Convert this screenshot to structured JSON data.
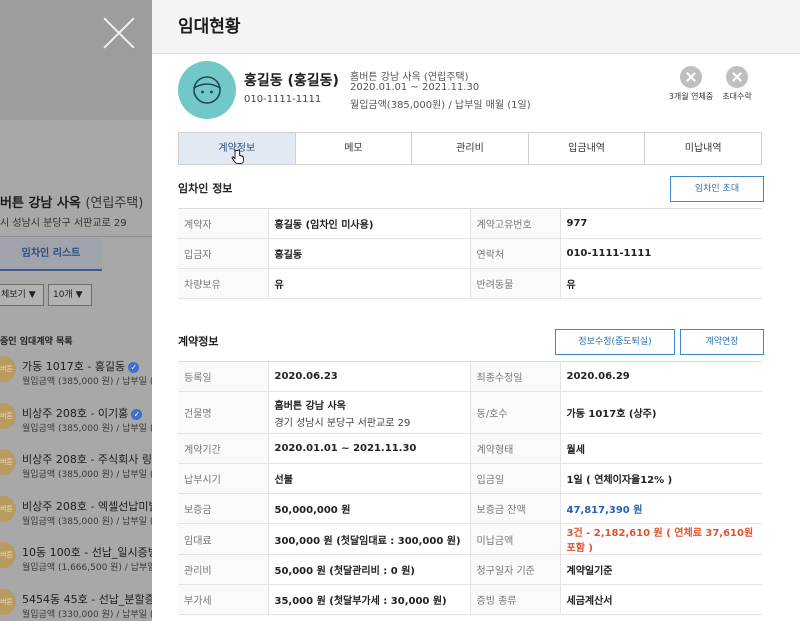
{
  "background": {
    "property_title": "버튼 강남 사옥",
    "property_type": "(연립주택)",
    "address": "시 성남시 분당구 서판교로 29",
    "tab_label": "임차인 리스트",
    "filter_select": "체보기 ▼",
    "page_size_select": "10개 ▼",
    "list_title": "중인 임대계약 목록",
    "avatar_text": "버튼",
    "items": [
      {
        "name": "가동 1017호 - 홍길동",
        "sub": "월입금액 (385,000 원) / 납부일 (1일",
        "verified": true
      },
      {
        "name": "비상주 208호 - 이기홍",
        "sub": "월입금액 (385,000 원) / 납부일 (1일",
        "verified": true
      },
      {
        "name": "비상주 208호 - 주식회사 링크해",
        "sub": "월입금액 (385,000 원) / 납부일 (1일",
        "verified": false
      },
      {
        "name": "비상주 208호 - 엑셀선납미발행",
        "sub": "월입금액 (385,000 원) / 납부일 (1일",
        "verified": false
      },
      {
        "name": "10동 100호 - 선납_일시증빙_오",
        "sub": "월입금액 (1,666,500 원) / 납부일 (1",
        "verified": false
      },
      {
        "name": "5454동 45호 - 선납_분할증빙",
        "sub": "월입금액 (330,000 원) / 납부일 (1일",
        "verified": false
      }
    ],
    "check_glyph": "✓"
  },
  "panel": {
    "title": "임대현황",
    "profile": {
      "name": "홍길동 (홍길동)",
      "phone": "010-1111-1111",
      "property": "홈버튼 강남 사옥 (연립주택)",
      "period": "2020.01.01 ~ 2021.11.30",
      "payment": "월입금액(385,000원) / 납부일 매월 (1일)"
    },
    "actions": [
      {
        "label": "3개월 연체중"
      },
      {
        "label": "초대수락"
      }
    ],
    "tabs": [
      "계약정보",
      "메모",
      "관리비",
      "입금내역",
      "미납내역"
    ],
    "tenant_section": {
      "title": "임차인 정보",
      "invite_button": "임차인 초대",
      "rows": [
        [
          {
            "k": "계약자",
            "v": "홍길동 (임차인 미사용)"
          },
          {
            "k": "계약고유번호",
            "v": "977"
          }
        ],
        [
          {
            "k": "입금자",
            "v": "홍길동"
          },
          {
            "k": "연락처",
            "v": "010-1111-1111"
          }
        ],
        [
          {
            "k": "차량보유",
            "v": "유"
          },
          {
            "k": "반려동물",
            "v": "유"
          }
        ]
      ]
    },
    "contract_section": {
      "title": "계약정보",
      "edit_button": "정보수정(중도퇴실)",
      "extend_button": "계약연장",
      "rows": [
        [
          {
            "k": "등록일",
            "v": "2020.06.23"
          },
          {
            "k": "최종수정일",
            "v": "2020.06.29"
          }
        ],
        [
          {
            "k": "건물명",
            "v": "홈버튼 강남 사옥",
            "v2": "경기 성남시 분당구 서판교로 29"
          },
          {
            "k": "동/호수",
            "v": "가동 1017호 (상주)"
          }
        ],
        [
          {
            "k": "계약기간",
            "v": "2020.01.01 ~ 2021.11.30"
          },
          {
            "k": "계약형태",
            "v": "월세"
          }
        ],
        [
          {
            "k": "납부시기",
            "v": "선불"
          },
          {
            "k": "입금일",
            "v": "1일 ( 연체이자율12% )"
          }
        ],
        [
          {
            "k": "보증금",
            "v": "50,000,000 원"
          },
          {
            "k": "보증금 잔액",
            "v": "47,817,390 원"
          }
        ],
        [
          {
            "k": "임대료",
            "v": "300,000 원 (첫달임대료 : 300,000 원)"
          },
          {
            "k": "미납금액",
            "v": "3건 - 2,182,610 원 ( 연체료 37,610원 포함 )"
          }
        ],
        [
          {
            "k": "관리비",
            "v": "50,000 원 (첫달관리비 : 0 원)"
          },
          {
            "k": "청구일자 기준",
            "v": "계약일기준"
          }
        ],
        [
          {
            "k": "부가세",
            "v": "35,000 원 (첫달부가세 : 30,000 원)"
          },
          {
            "k": "증빙 종류",
            "v": "세금계산서"
          }
        ]
      ]
    }
  },
  "colors": {
    "accent": "#2c4d82",
    "avatar": "#72c8c9",
    "deposit_balance": "#2660b8",
    "unpaid": "#e0542c"
  }
}
